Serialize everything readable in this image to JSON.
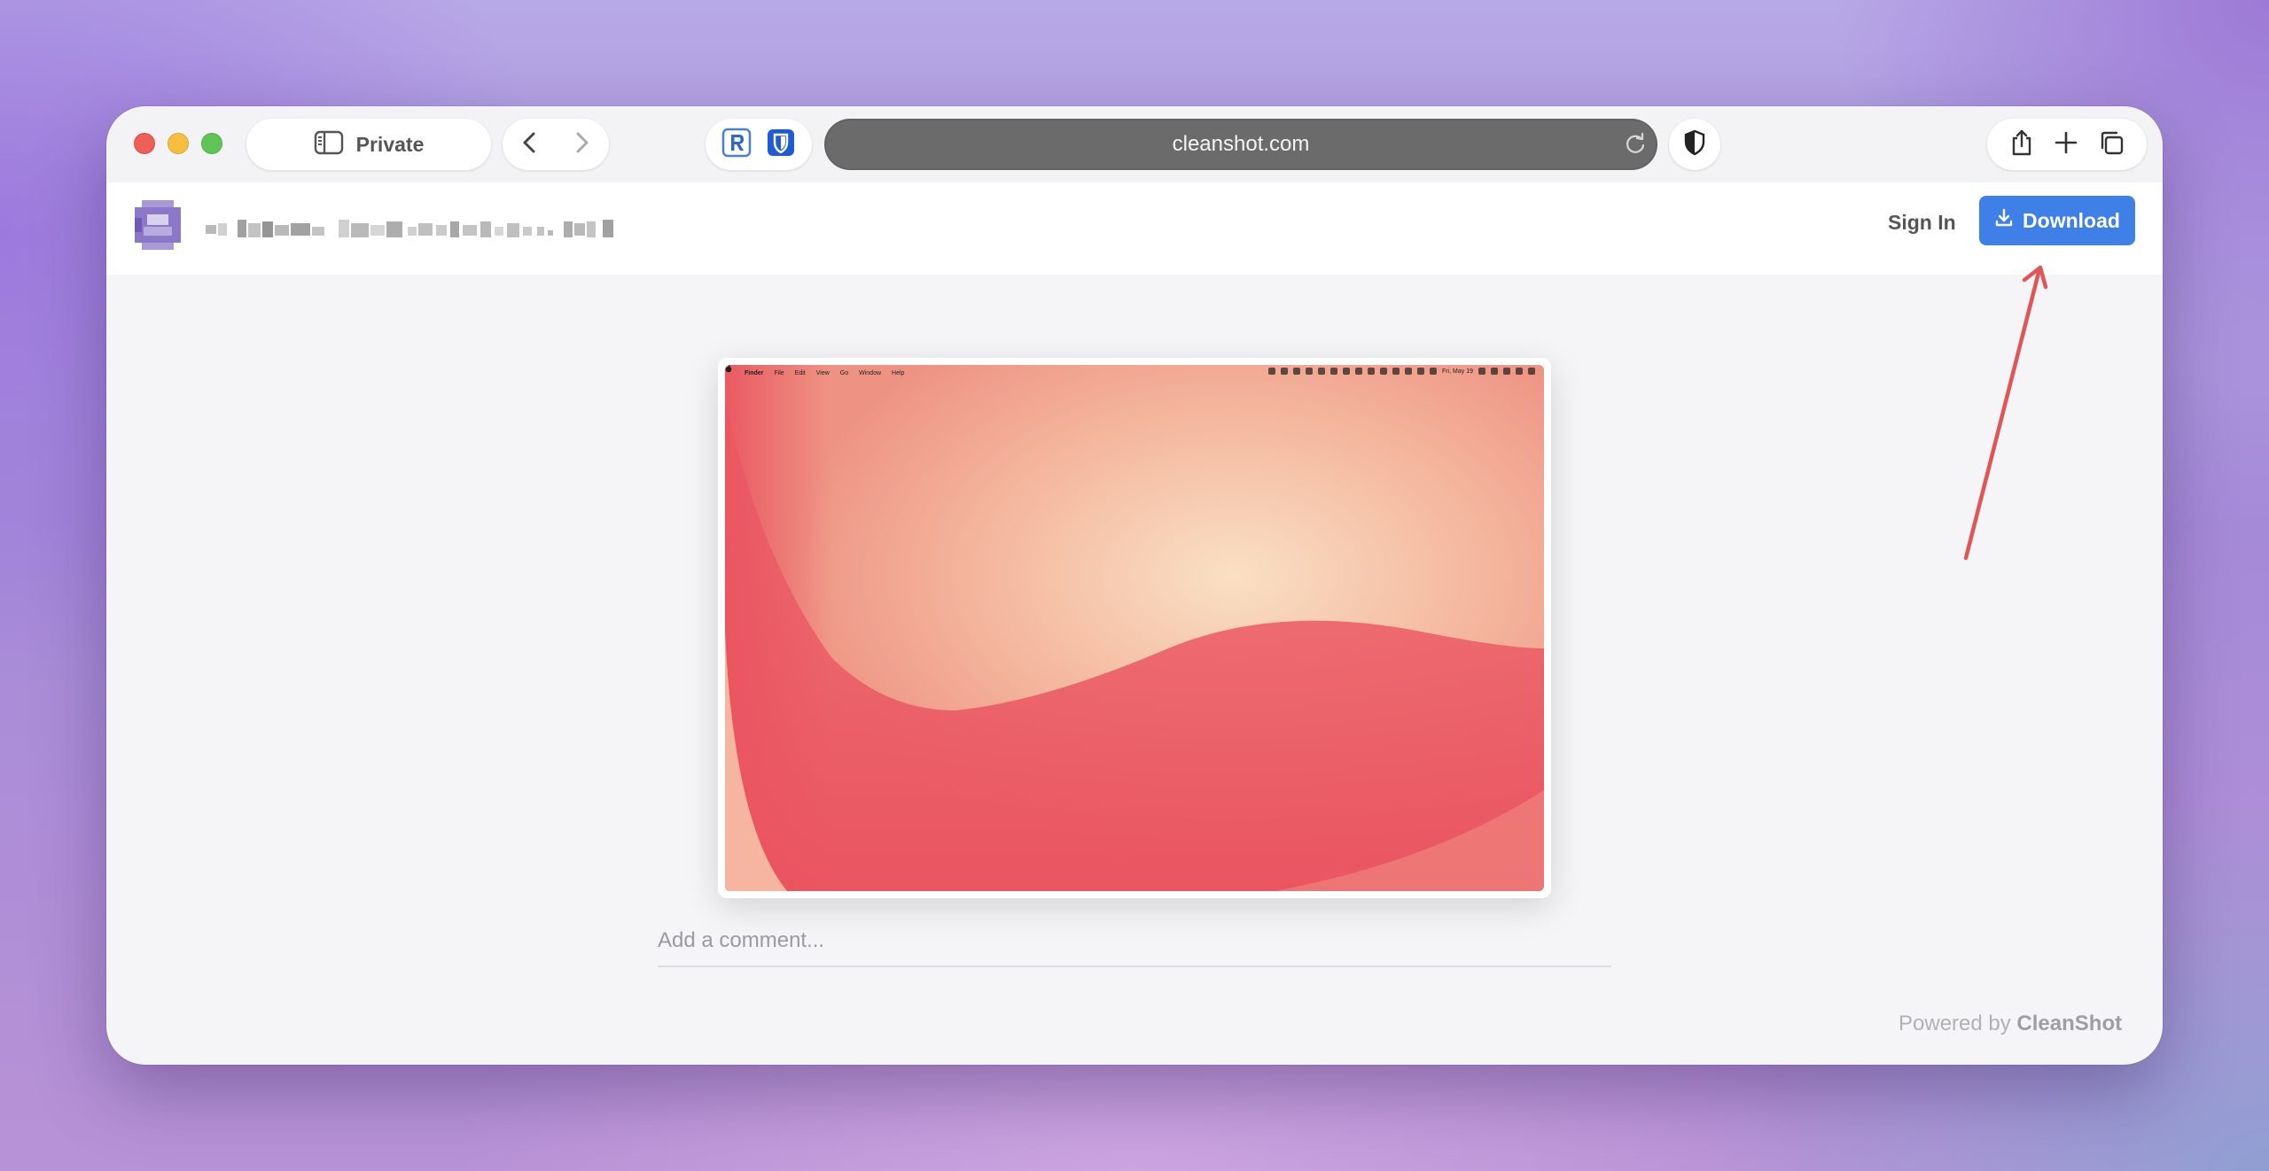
{
  "browser": {
    "private_label": "Private",
    "url": "cleanshot.com"
  },
  "header": {
    "sign_in_label": "Sign In",
    "download_label": "Download"
  },
  "preview_menubar": {
    "items": [
      "Finder",
      "File",
      "Edit",
      "View",
      "Go",
      "Window",
      "Help"
    ],
    "date": "Fri, May 19"
  },
  "comment": {
    "placeholder": "Add a comment..."
  },
  "footer": {
    "powered_prefix": "Powered by",
    "powered_brand": "CleanShot"
  },
  "colors": {
    "accent": "#3f7fe8",
    "annotation_arrow": "#e05555"
  }
}
